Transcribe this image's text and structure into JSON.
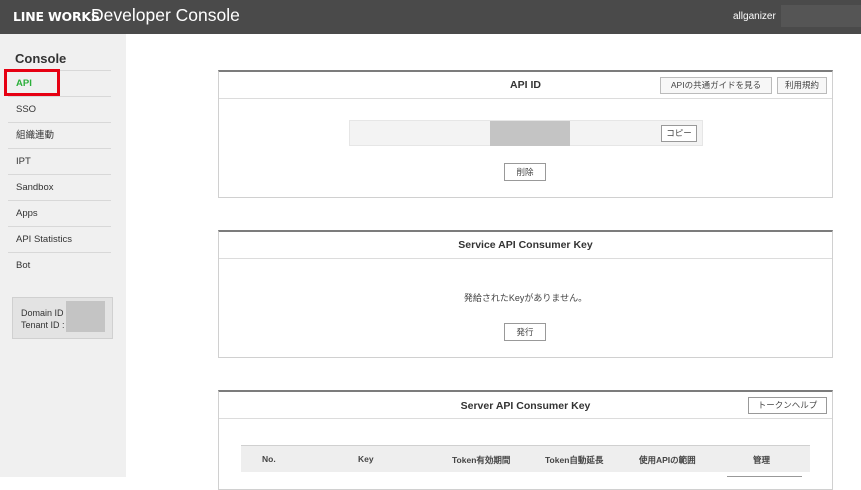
{
  "header": {
    "brand": "LINE WORKS",
    "product": "Developer Console",
    "user": "allganizer"
  },
  "sidebar": {
    "title": "Console",
    "items": [
      {
        "label": "API",
        "active": true
      },
      {
        "label": "SSO"
      },
      {
        "label": "組織連動"
      },
      {
        "label": "IPT"
      },
      {
        "label": "Sandbox"
      },
      {
        "label": "Apps"
      },
      {
        "label": "API Statistics"
      },
      {
        "label": "Bot"
      }
    ],
    "domain_label": "Domain ID :",
    "tenant_label": "Tenant ID :"
  },
  "api_id": {
    "title": "API ID",
    "guide_button": "APIの共通ガイドを見る",
    "terms_button": "利用規約",
    "copy_button": "コピー",
    "delete_button": "削除"
  },
  "service_key": {
    "title": "Service API Consumer Key",
    "empty_message": "発給されたKeyがありません。",
    "issue_button": "発行"
  },
  "server_key": {
    "title": "Server API Consumer Key",
    "help_button": "トークンヘルプ",
    "columns": [
      "No.",
      "Key",
      "Token有効期間",
      "Token自動延長",
      "使用APIの範囲",
      "管理"
    ]
  }
}
